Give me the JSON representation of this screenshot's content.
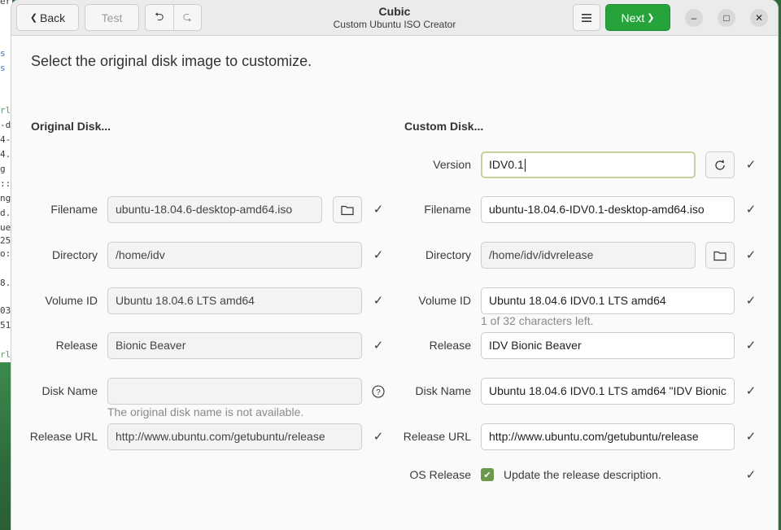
{
  "background": {
    "terminal_lines": [
      {
        "text": "err",
        "color": "plain"
      },
      {
        "text": "s",
        "color": "blue"
      },
      {
        "text": "s",
        "color": "blue"
      },
      {
        "text": "rl",
        "color": "green"
      },
      {
        "text": "-d",
        "color": "plain"
      },
      {
        "text": "4-",
        "color": "plain"
      },
      {
        "text": "4.",
        "color": "plain"
      },
      {
        "text": "g",
        "color": "plain"
      },
      {
        "text": "::",
        "color": "plain"
      },
      {
        "text": "ng",
        "color": "plain"
      },
      {
        "text": "d.",
        "color": "plain"
      },
      {
        "text": "ue",
        "color": "plain"
      },
      {
        "text": "25",
        "color": "plain"
      },
      {
        "text": "o:",
        "color": "plain"
      },
      {
        "text": "8.",
        "color": "plain"
      },
      {
        "text": "03",
        "color": "plain"
      },
      {
        "text": "51",
        "color": "plain"
      },
      {
        "text": "rl",
        "color": "green"
      }
    ]
  },
  "header": {
    "back_label": "Back",
    "test_label": "Test",
    "title": "Cubic",
    "subtitle": "Custom Ubuntu ISO Creator",
    "next_label": "Next",
    "menu_icon": "hamburger-menu-icon"
  },
  "main": {
    "heading": "Select the original disk image to customize."
  },
  "original": {
    "title": "Original Disk...",
    "filename_label": "Filename",
    "filename": "ubuntu-18.04.6-desktop-amd64.iso",
    "directory_label": "Directory",
    "directory": "/home/idv",
    "volume_label": "Volume ID",
    "volume_id": "Ubuntu 18.04.6 LTS amd64",
    "release_label": "Release",
    "release": "Bionic Beaver",
    "disk_name_label": "Disk Name",
    "disk_name": "",
    "disk_name_hint": "The original disk name is not available.",
    "release_url_label": "Release URL",
    "release_url": "http://www.ubuntu.com/getubuntu/release"
  },
  "custom": {
    "title": "Custom Disk...",
    "version_label": "Version",
    "version": "IDV0.1",
    "filename_label": "Filename",
    "filename": "ubuntu-18.04.6-IDV0.1-desktop-amd64.iso",
    "directory_label": "Directory",
    "directory": "/home/idv/idvrelease",
    "volume_label": "Volume ID",
    "volume_id": "Ubuntu 18.04.6 IDV0.1 LTS amd64",
    "volume_hint": "1 of 32 characters left.",
    "release_label": "Release",
    "release": "IDV Bionic Beaver",
    "disk_name_label": "Disk Name",
    "disk_name": "Ubuntu 18.04.6 IDV0.1 LTS amd64 \"IDV Bionic",
    "release_url_label": "Release URL",
    "release_url": "http://www.ubuntu.com/getubuntu/release",
    "os_release_label": "OS Release",
    "os_release_checked": true,
    "os_release_text": "Update the release description."
  },
  "glyphs": {
    "back_chevron": "❮",
    "next_chevron": "❯",
    "undo": "⮌",
    "redo": "⮎",
    "minimize": "–",
    "maximize": "□",
    "close": "✕",
    "check": "✓",
    "checkbox_tick": "✔"
  },
  "colors": {
    "next_button": "#26a33a",
    "checkbox": "#6c9a4c",
    "focus_ring": "#c9cf9e"
  }
}
